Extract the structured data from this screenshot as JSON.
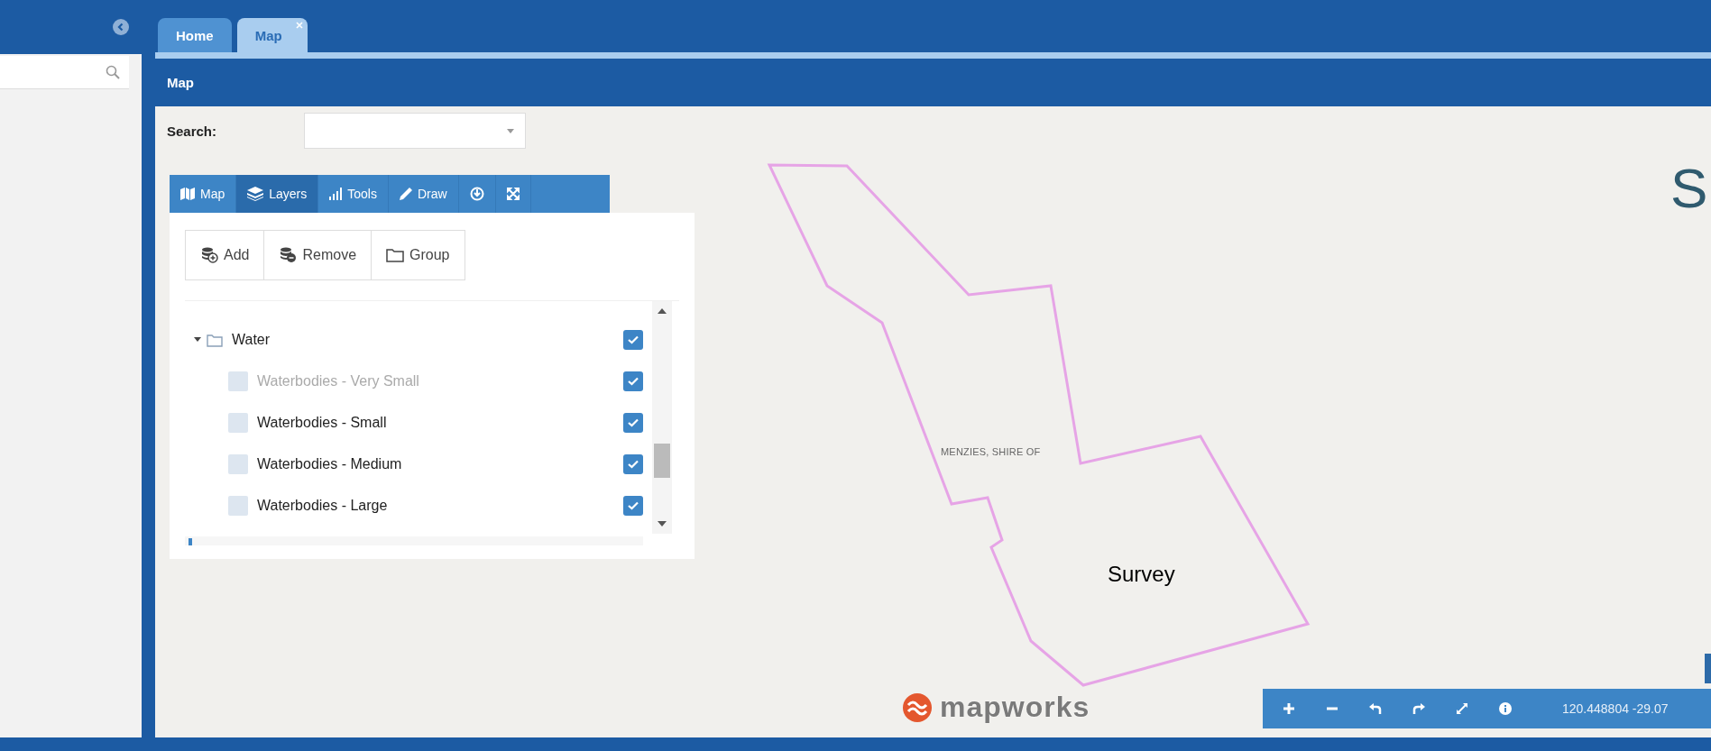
{
  "tabs": [
    {
      "label": "Home",
      "selected": false,
      "closable": false
    },
    {
      "label": "Map",
      "selected": true,
      "closable": true
    }
  ],
  "header": {
    "title": "Map"
  },
  "search": {
    "label": "Search:"
  },
  "panel_tabs": [
    {
      "label": "Map",
      "kind": "map",
      "selected": false
    },
    {
      "label": "Layers",
      "kind": "layers",
      "selected": true
    },
    {
      "label": "Tools",
      "kind": "chart",
      "selected": false
    },
    {
      "label": "Draw",
      "kind": "pencil",
      "selected": false
    },
    {
      "kind": "download",
      "selected": false
    },
    {
      "kind": "expand",
      "selected": false
    }
  ],
  "layer_actions": [
    {
      "label": "Add",
      "kind": "add"
    },
    {
      "label": "Remove",
      "kind": "remove"
    },
    {
      "label": "Group",
      "kind": "folder"
    }
  ],
  "layers": [
    {
      "label": "Water",
      "expanded": true,
      "checked": true,
      "children": [
        {
          "label": "Waterbodies - Very Small",
          "selected": false,
          "checked": true,
          "dimmed": true
        },
        {
          "label": "Waterbodies - Small",
          "selected": false,
          "checked": true,
          "dimmed": false
        },
        {
          "label": "Waterbodies - Medium",
          "selected": false,
          "checked": true,
          "dimmed": false
        },
        {
          "label": "Waterbodies - Large",
          "selected": false,
          "checked": true,
          "dimmed": false
        }
      ]
    }
  ],
  "map": {
    "labels": [
      {
        "text": "MENZIES, SHIRE OF",
        "kind": "region"
      },
      {
        "text": "Survey",
        "kind": "annotation"
      }
    ],
    "logo": "mapworks",
    "edge_logo": "S",
    "controls": [
      {
        "kind": "zoom-in"
      },
      {
        "kind": "zoom-out"
      },
      {
        "kind": "undo"
      },
      {
        "kind": "redo"
      },
      {
        "kind": "fit"
      },
      {
        "kind": "info"
      }
    ],
    "coordinates": "120.448804 -29.07"
  }
}
